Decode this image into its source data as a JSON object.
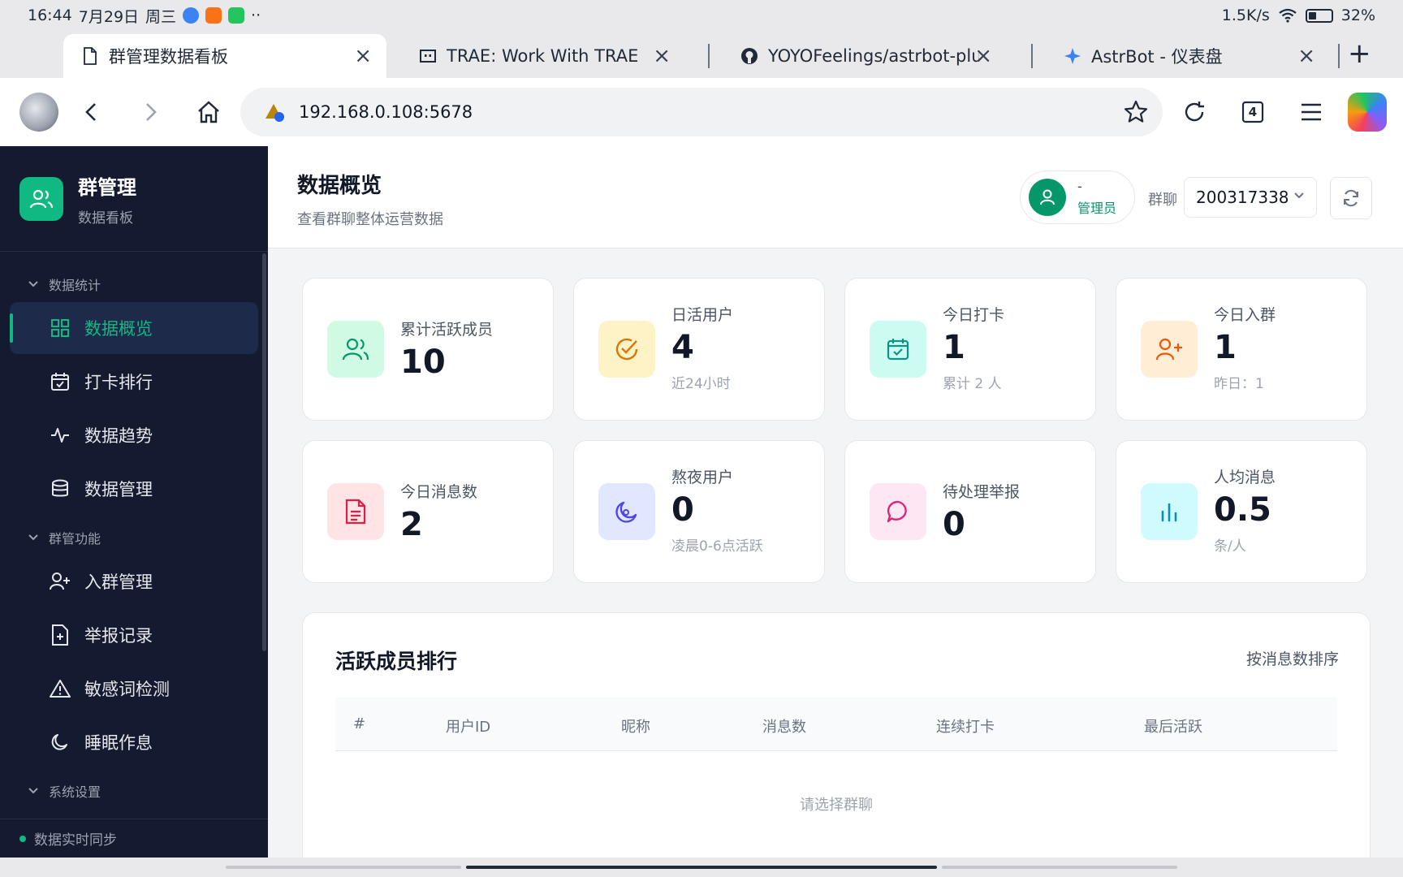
{
  "status_bar": {
    "time": "16:44",
    "date": "7月29日",
    "weekday": "周三",
    "more": "··",
    "net_speed": "1.5K/s",
    "battery": "32%"
  },
  "tabs": [
    {
      "label": "群管理数据看板",
      "active": true
    },
    {
      "label": "TRAE: Work With TRAE",
      "active": false
    },
    {
      "label": "YOYOFeelings/astrbot-plug",
      "active": false
    },
    {
      "label": "AstrBot - 仪表盘",
      "active": false
    }
  ],
  "toolbar": {
    "url": "192.168.0.108:5678",
    "tab_count": "4"
  },
  "sidebar": {
    "title": "群管理",
    "subtitle": "数据看板",
    "sections": [
      {
        "label": "数据统计"
      },
      {
        "label": "群管功能"
      },
      {
        "label": "系统设置"
      }
    ],
    "items": [
      {
        "label": "数据概览"
      },
      {
        "label": "打卡排行"
      },
      {
        "label": "数据趋势"
      },
      {
        "label": "数据管理"
      },
      {
        "label": "入群管理"
      },
      {
        "label": "举报记录"
      },
      {
        "label": "敏感词检测"
      },
      {
        "label": "睡眠作息"
      }
    ],
    "footer": "数据实时同步"
  },
  "header": {
    "title": "数据概览",
    "subtitle": "查看群聊整体运营数据",
    "user_name": "-",
    "user_role": "管理员",
    "group_label": "群聊",
    "group_value": "200317338"
  },
  "stats": [
    {
      "label": "累计活跃成员",
      "value": "10",
      "sub": ""
    },
    {
      "label": "日活用户",
      "value": "4",
      "sub": "近24小时"
    },
    {
      "label": "今日打卡",
      "value": "1",
      "sub": "累计 2 人"
    },
    {
      "label": "今日入群",
      "value": "1",
      "sub": "昨日：1"
    },
    {
      "label": "今日消息数",
      "value": "2",
      "sub": ""
    },
    {
      "label": "熬夜用户",
      "value": "0",
      "sub": "凌晨0-6点活跃"
    },
    {
      "label": "待处理举报",
      "value": "0",
      "sub": ""
    },
    {
      "label": "人均消息",
      "value": "0.5",
      "sub": "条/人"
    }
  ],
  "ranking": {
    "title": "活跃成员排行",
    "sort_label": "按消息数排序",
    "columns": [
      "#",
      "用户ID",
      "昵称",
      "消息数",
      "连续打卡",
      "最后活跃"
    ],
    "empty_text": "请选择群聊"
  },
  "colors": {
    "accent": "#10b981",
    "sidebar_bg": "#141a2f"
  }
}
